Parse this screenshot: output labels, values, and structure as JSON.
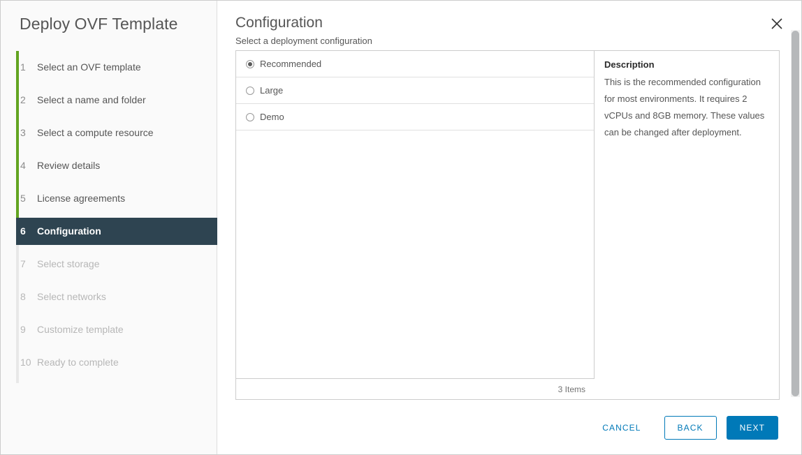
{
  "window": {
    "title": "Deploy OVF Template",
    "close_icon": "close-icon"
  },
  "sidebar": {
    "steps": [
      {
        "num": "1",
        "label": "Select an OVF template",
        "state": "done"
      },
      {
        "num": "2",
        "label": "Select a name and folder",
        "state": "done"
      },
      {
        "num": "3",
        "label": "Select a compute resource",
        "state": "done"
      },
      {
        "num": "4",
        "label": "Review details",
        "state": "done"
      },
      {
        "num": "5",
        "label": "License agreements",
        "state": "done"
      },
      {
        "num": "6",
        "label": "Configuration",
        "state": "active"
      },
      {
        "num": "7",
        "label": "Select storage",
        "state": "upcoming"
      },
      {
        "num": "8",
        "label": "Select networks",
        "state": "upcoming"
      },
      {
        "num": "9",
        "label": "Customize template",
        "state": "upcoming"
      },
      {
        "num": "10",
        "label": "Ready to complete",
        "state": "upcoming"
      }
    ],
    "progress_color": "#62a420"
  },
  "main": {
    "title": "Configuration",
    "subtitle": "Select a deployment configuration",
    "options": [
      {
        "label": "Recommended",
        "selected": true
      },
      {
        "label": "Large",
        "selected": false
      },
      {
        "label": "Demo",
        "selected": false
      }
    ],
    "item_count_label": "3 Items",
    "description": {
      "heading": "Description",
      "text": "This is the recommended configuration for most environments. It requires 2 vCPUs and 8GB memory. These values can be changed after deployment."
    }
  },
  "footer": {
    "cancel_label": "CANCEL",
    "back_label": "BACK",
    "next_label": "NEXT",
    "accent_color": "#0079b8"
  }
}
